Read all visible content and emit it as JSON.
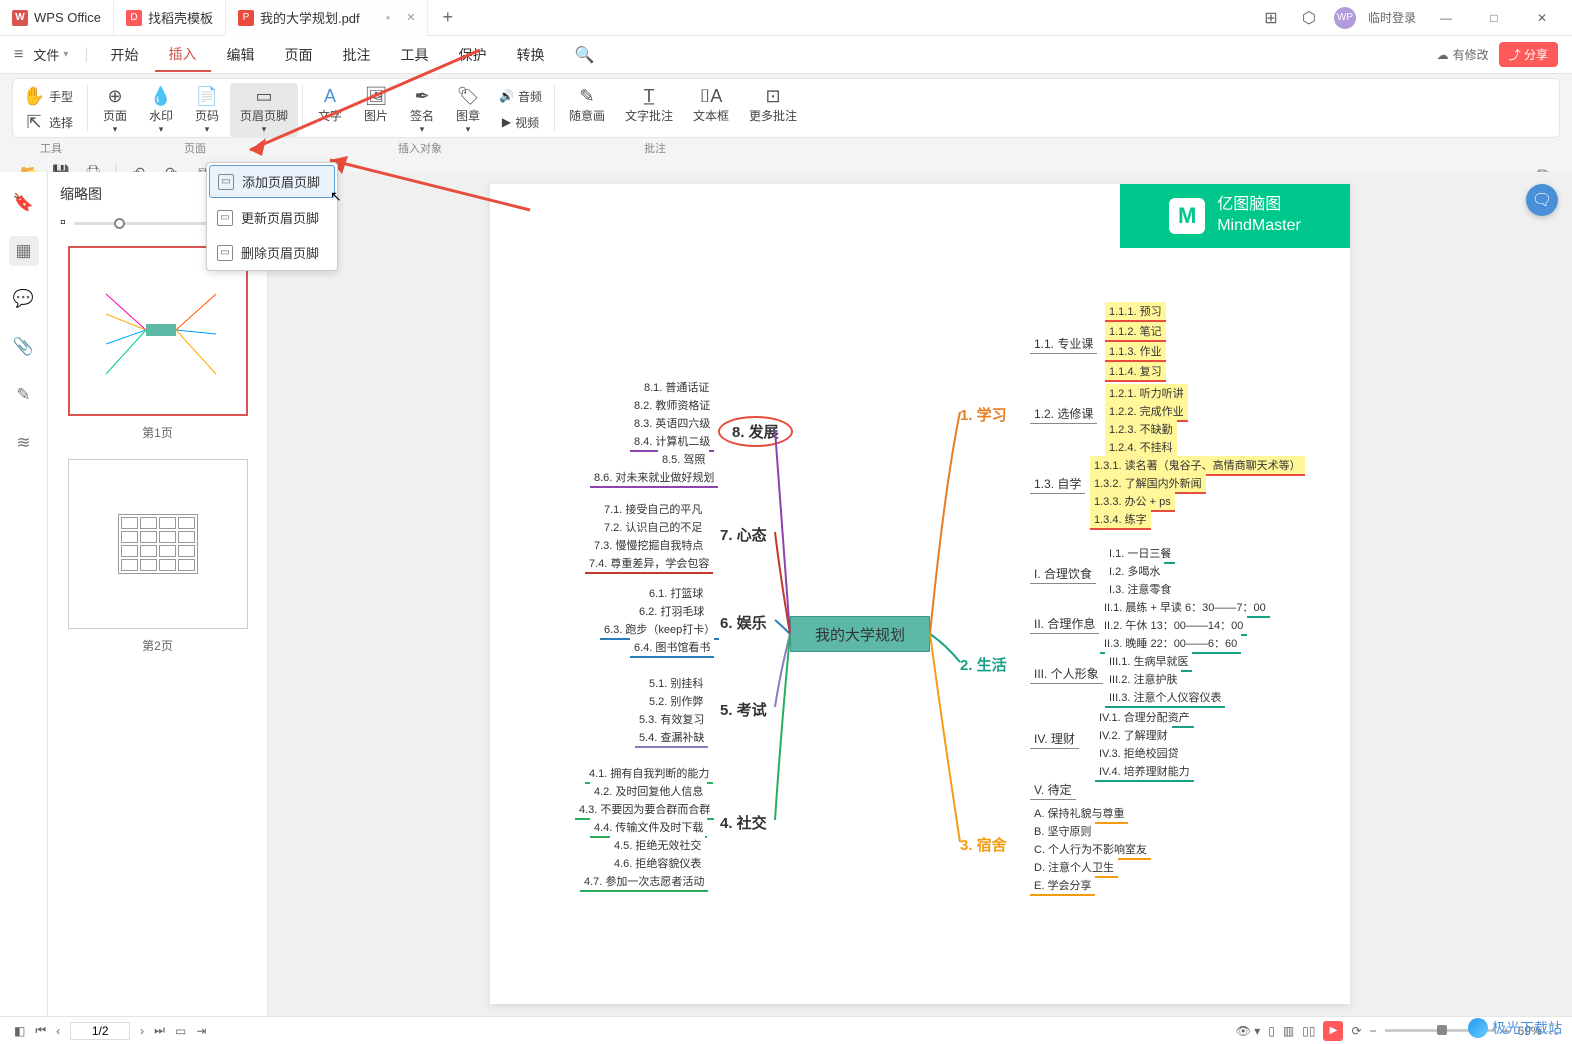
{
  "tabs": {
    "t1": "WPS Office",
    "t2": "找稻壳模板",
    "t3": "我的大学规划.pdf"
  },
  "titleRight": {
    "login": "临时登录"
  },
  "fileMenu": "文件",
  "menu": {
    "start": "开始",
    "insert": "插入",
    "edit": "编辑",
    "page": "页面",
    "annotate": "批注",
    "tool": "工具",
    "protect": "保护",
    "convert": "转换"
  },
  "cloud": "有修改",
  "share": "分享",
  "ribbon": {
    "hand": "手型",
    "select": "选择",
    "pageAdd": "页面",
    "watermark": "水印",
    "pageNum": "页码",
    "headerFooter": "页眉页脚",
    "text": "文字",
    "image": "图片",
    "sign": "签名",
    "stamp": "图章",
    "audio": "音频",
    "video": "视频",
    "freehand": "随意画",
    "textAnnot": "文字批注",
    "textbox": "文本框",
    "moreAnnot": "更多批注",
    "grpTool": "工具",
    "grpPage": "页面",
    "grpInsert": "插入对象",
    "grpAnnot": "批注"
  },
  "dropdown": {
    "add": "添加页眉页脚",
    "update": "更新页眉页脚",
    "delete": "删除页眉页脚"
  },
  "thumb": {
    "title": "缩略图",
    "p1": "第1页",
    "p2": "第2页"
  },
  "status": {
    "page": "1/2",
    "zoom": "69%"
  },
  "mindmaster": {
    "cn": "亿图脑图",
    "en": "MindMaster"
  },
  "center": "我的大学规划",
  "right": {
    "r1": "1. 学习",
    "r1_1": "1.1. 专业课",
    "r1_1_1": "1.1.1. 预习",
    "r1_1_2": "1.1.2. 笔记",
    "r1_1_3": "1.1.3. 作业",
    "r1_1_4": "1.1.4. 复习",
    "r1_2": "1.2. 选修课",
    "r1_2_1": "1.2.1. 听力听讲",
    "r1_2_2": "1.2.2. 完成作业",
    "r1_2_3": "1.2.3. 不缺勤",
    "r1_2_4": "1.2.4. 不挂科",
    "r1_3": "1.3. 自学",
    "r1_3_1": "1.3.1. 读名著（鬼谷子、高情商聊天术等）",
    "r1_3_2": "1.3.2. 了解国内外新闻",
    "r1_3_3": "1.3.3. 办公 + ps",
    "r1_3_4": "1.3.4. 练字",
    "r2": "2. 生活",
    "r2_1": "I. 合理饮食",
    "r2_1_1": "I.1. 一日三餐",
    "r2_1_2": "I.2. 多喝水",
    "r2_1_3": "I.3. 注意零食",
    "r2_2": "II. 合理作息",
    "r2_2_1": "II.1. 晨练 + 早读 6：30——7：00",
    "r2_2_2": "II.2. 午休  13：00——14：00",
    "r2_2_3": "II.3. 晚睡  22：00——6：60",
    "r2_3": "III. 个人形象",
    "r2_3_1": "III.1. 生病早就医",
    "r2_3_2": "III.2. 注意护肤",
    "r2_3_3": "III.3. 注意个人仪容仪表",
    "r2_4": "IV. 理财",
    "r2_4_1": "IV.1. 合理分配资产",
    "r2_4_2": "IV.2. 了解理财",
    "r2_4_3": "IV.3. 拒绝校园贷",
    "r2_4_4": "IV.4. 培养理财能力",
    "r2_5": "V. 待定",
    "r3": "3. 宿舍",
    "r3_1": "A. 保持礼貌与尊重",
    "r3_2": "B. 坚守原则",
    "r3_3": "C. 个人行为不影响室友",
    "r3_4": "D. 注意个人卫生",
    "r3_5": "E. 学会分享"
  },
  "left": {
    "l8": "8. 发展",
    "l8_1": "8.1. 普通话证",
    "l8_2": "8.2. 教师资格证",
    "l8_3": "8.3. 英语四六级",
    "l8_4": "8.4. 计算机二级",
    "l8_5": "8.5. 驾照",
    "l8_6": "8.6. 对未来就业做好规划",
    "l7": "7. 心态",
    "l7_1": "7.1. 接受自己的平凡",
    "l7_2": "7.2. 认识自己的不足",
    "l7_3": "7.3. 慢慢挖掘自我特点",
    "l7_4": "7.4. 尊重差异，学会包容",
    "l6": "6. 娱乐",
    "l6_1": "6.1. 打篮球",
    "l6_2": "6.2. 打羽毛球",
    "l6_3": "6.3. 跑步（keep打卡）",
    "l6_4": "6.4. 图书馆看书",
    "l5": "5. 考试",
    "l5_1": "5.1. 别挂科",
    "l5_2": "5.2. 别作弊",
    "l5_3": "5.3. 有效复习",
    "l5_4": "5.4. 查漏补缺",
    "l4": "4. 社交",
    "l4_1": "4.1. 拥有自我判断的能力",
    "l4_2": "4.2. 及时回复他人信息",
    "l4_3": "4.3. 不要因为要合群而合群",
    "l4_4": "4.4. 传输文件及时下载",
    "l4_5": "4.5. 拒绝无效社交",
    "l4_6": "4.6. 拒绝容貌仪表",
    "l4_7": "4.7. 参加一次志愿者活动"
  },
  "watermark": "极光下载站"
}
